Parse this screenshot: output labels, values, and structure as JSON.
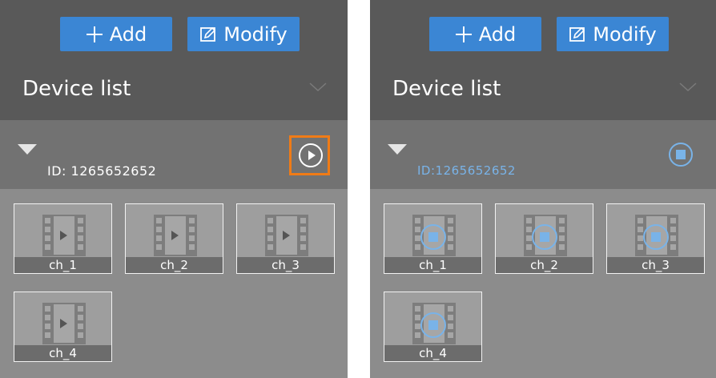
{
  "left": {
    "buttons": {
      "add": "Add",
      "modify": "Modify"
    },
    "title": "Device list",
    "device": {
      "id_label": "ID:",
      "id_value": "1265652652"
    },
    "channels": [
      "ch_1",
      "ch_2",
      "ch_3",
      "ch_4"
    ]
  },
  "right": {
    "buttons": {
      "add": "Add",
      "modify": "Modify"
    },
    "title": "Device list",
    "device": {
      "id_label": "ID:",
      "id_value": "1265652652"
    },
    "channels": [
      "ch_1",
      "ch_2",
      "ch_3",
      "ch_4"
    ]
  },
  "colors": {
    "accent": "#3b86d4",
    "highlight": "#f07b16",
    "playing": "#79b3e8"
  },
  "icons": {
    "add": "plus-icon",
    "modify": "edit-icon",
    "collapse": "chevron-down-icon",
    "expand": "triangle-down-icon",
    "play": "play-icon",
    "stop": "stop-icon",
    "channel": "film-icon"
  }
}
